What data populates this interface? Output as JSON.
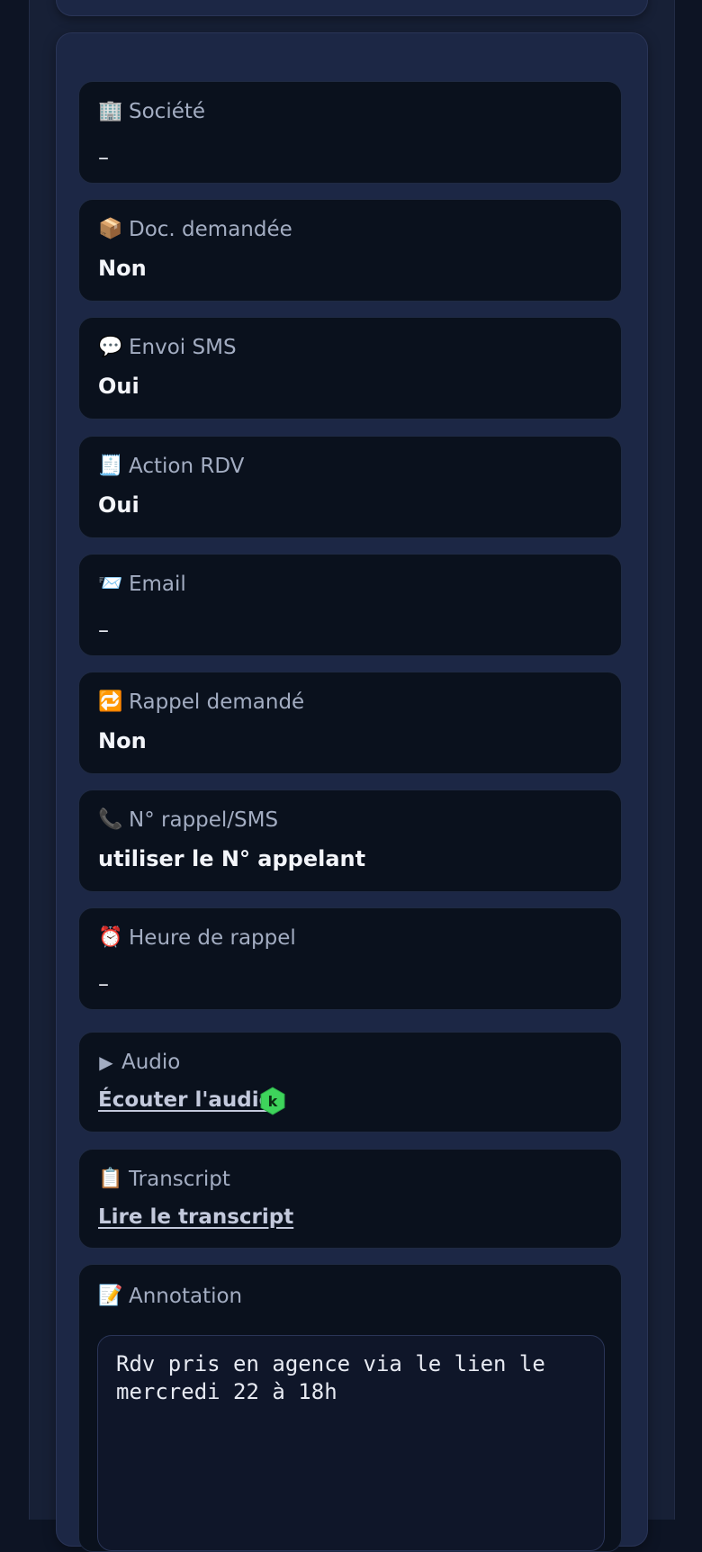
{
  "fields": [
    {
      "icon": "building-icon",
      "glyph": "🏢",
      "label": "Société",
      "value": "–"
    },
    {
      "icon": "package-icon",
      "glyph": "📦",
      "label": "Doc. demandée",
      "value": "Non"
    },
    {
      "icon": "speech-bubble-icon",
      "glyph": "💬",
      "label": "Envoi SMS",
      "value": "Oui"
    },
    {
      "icon": "receipt-icon",
      "glyph": "🧾",
      "label": "Action RDV",
      "value": "Oui"
    },
    {
      "icon": "envelope-icon",
      "glyph": "📨",
      "label": "Email",
      "value": "–"
    },
    {
      "icon": "repeat-icon",
      "glyph": "🔁",
      "label": "Rappel demandé",
      "value": "Non"
    },
    {
      "icon": "phone-icon",
      "glyph": "📞",
      "label": "N° rappel/SMS",
      "value": "utiliser le N° appelant"
    },
    {
      "icon": "alarm-clock-icon",
      "glyph": "⏰",
      "label": "Heure de rappel",
      "value": "–"
    }
  ],
  "audio": {
    "icon": "play-icon",
    "glyph": "▶",
    "label": "Audio",
    "link": "Écouter l'audio",
    "badge_letter": "k",
    "badge_color": "#3ed45b"
  },
  "transcript": {
    "icon": "clipboard-icon",
    "glyph": "📋",
    "label": "Transcript",
    "link": "Lire le transcript"
  },
  "annotation": {
    "icon": "memo-icon",
    "glyph": "📝",
    "label": "Annotation",
    "text": "Rdv pris en agence via le lien le\nmercredi 22 à 18h"
  }
}
